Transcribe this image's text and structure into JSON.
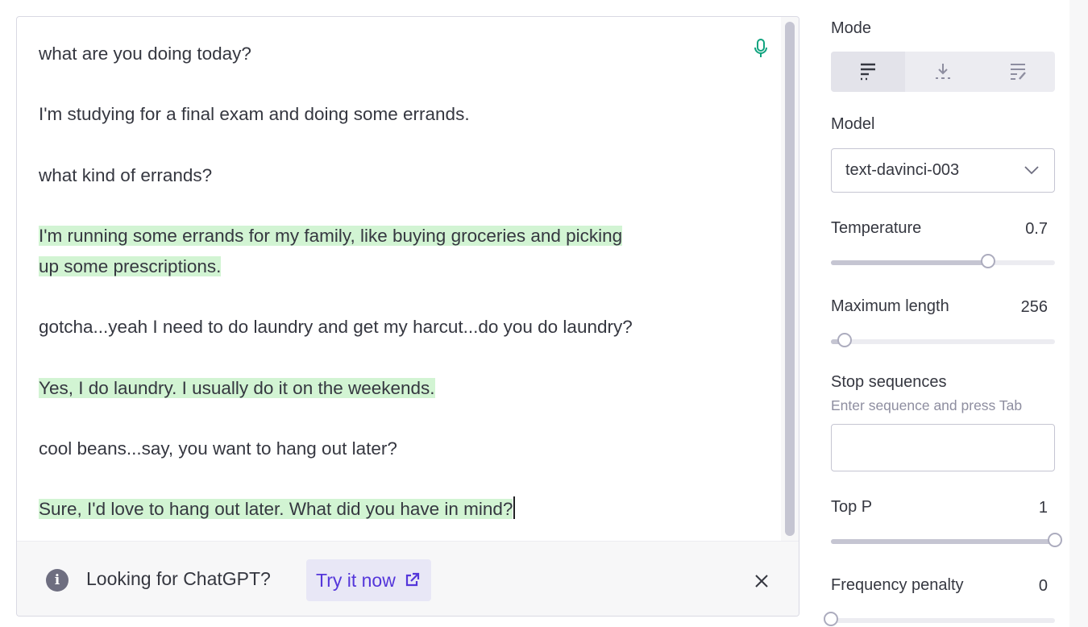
{
  "editor": {
    "lines": [
      {
        "text": "what are you doing today?",
        "generated": false
      },
      {
        "text": "I'm studying for a final exam and doing some errands.",
        "generated": false
      },
      {
        "text": "what kind of errands?",
        "generated": false
      },
      {
        "text": "I'm running some errands for my family, like buying groceries and picking",
        "generated": true
      },
      {
        "text": "up some prescriptions.",
        "generated": true
      },
      {
        "text": "gotcha...yeah I need to do laundry and get my harcut...do you do laundry?",
        "generated": false
      },
      {
        "text": "Yes, I do laundry. I usually do it on the weekends.",
        "generated": true
      },
      {
        "text": "cool beans...say, you want to hang out later?",
        "generated": false
      },
      {
        "text": "Sure, I'd love to hang out later. What did you have in mind?",
        "generated": true
      }
    ]
  },
  "banner": {
    "text": "Looking for ChatGPT?",
    "link_label": "Try it now"
  },
  "settings": {
    "mode": {
      "label": "Mode",
      "options": [
        "complete-icon",
        "insert-icon",
        "edit-icon"
      ],
      "selected": 0
    },
    "model": {
      "label": "Model",
      "value": "text-davinci-003"
    },
    "temperature": {
      "label": "Temperature",
      "value": "0.7",
      "level": 0.7
    },
    "max_length": {
      "label": "Maximum length",
      "value": "256",
      "level": 0.061
    },
    "stop_sequences": {
      "label": "Stop sequences",
      "hint": "Enter sequence and press Tab"
    },
    "top_p": {
      "label": "Top P",
      "value": "1",
      "level": 1.0
    },
    "frequency_penalty": {
      "label": "Frequency penalty",
      "value": "0",
      "level": 0.0
    }
  },
  "colors": {
    "highlight": "#d2f4d3",
    "accent": "#5436da",
    "mic": "#10a37f"
  }
}
